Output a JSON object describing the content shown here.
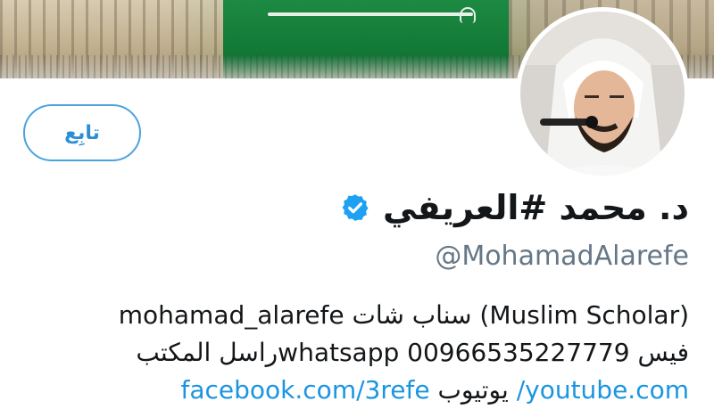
{
  "header": {
    "banner_icon": "saudi-flag-banner-with-sword",
    "avatar_icon": "profile-photo"
  },
  "profile": {
    "follow_label": "تابِع",
    "display_name": "د. محمد #العريفي",
    "verified_icon": "verified-badge-icon",
    "handle": "@MohamadAlarefe",
    "bio_line1": "mohamad_alarefe سناب شات (Muslim Scholar)",
    "bio_line2": "فيس 00966535227779 whatsappراسل المكتب",
    "bio_link_youtube": "youtube.com/",
    "bio_word_youtube": "يوتيوب",
    "bio_link_facebook": "facebook.com/3refe"
  },
  "colors": {
    "accent": "#1b95e0",
    "follow_border": "#4aa3df",
    "text_primary": "#14171a",
    "text_secondary": "#657786"
  }
}
